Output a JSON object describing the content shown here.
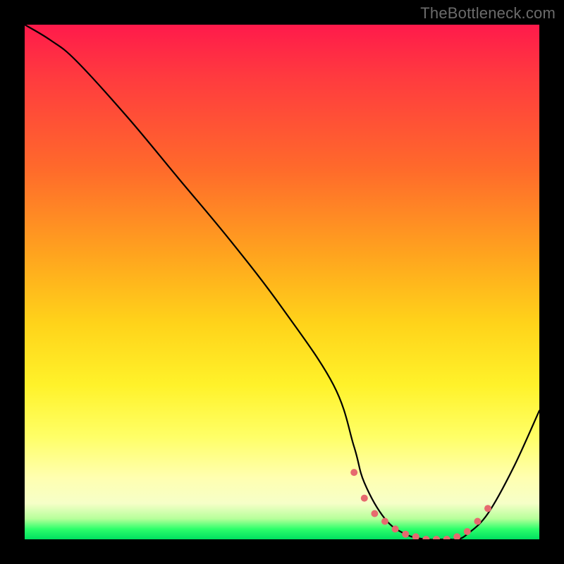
{
  "watermark": "TheBottleneck.com",
  "chart_data": {
    "type": "line",
    "title": "",
    "xlabel": "",
    "ylabel": "",
    "xlim": [
      0,
      100
    ],
    "ylim": [
      0,
      100
    ],
    "series": [
      {
        "name": "bottleneck-curve",
        "x": [
          0,
          5,
          10,
          20,
          30,
          40,
          50,
          60,
          64,
          66,
          70,
          74,
          78,
          82,
          84,
          86,
          90,
          95,
          100
        ],
        "y": [
          100,
          97,
          93,
          82,
          70,
          58,
          45,
          30,
          18,
          11,
          4,
          1,
          0,
          0,
          0,
          1,
          5,
          14,
          25
        ]
      }
    ],
    "markers": {
      "name": "valley-dots",
      "x": [
        64,
        66,
        68,
        70,
        72,
        74,
        76,
        78,
        80,
        82,
        84,
        86,
        88,
        90
      ],
      "y": [
        13,
        8,
        5,
        3.5,
        2,
        1,
        0.5,
        0,
        0,
        0,
        0.5,
        1.5,
        3.5,
        6
      ]
    },
    "colors": {
      "curve": "#000000",
      "dots": "#e66a6f",
      "gradient_top": "#ff1a4b",
      "gradient_bottom": "#00e060"
    }
  }
}
